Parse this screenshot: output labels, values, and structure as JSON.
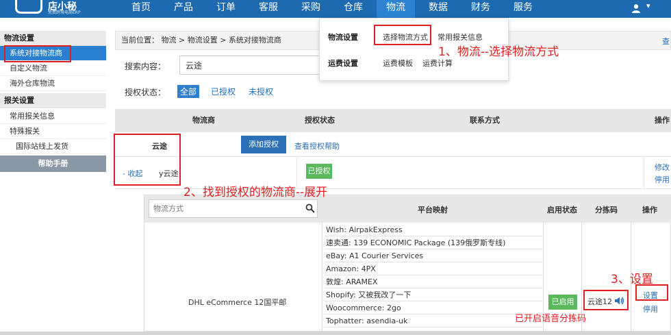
{
  "brand": {
    "name": "店小秘",
    "tagline": "免费跨境电商ERP"
  },
  "nav": {
    "items": [
      {
        "label": "首页"
      },
      {
        "label": "产品"
      },
      {
        "label": "订单"
      },
      {
        "label": "客服"
      },
      {
        "label": "采购"
      },
      {
        "label": "仓库"
      },
      {
        "label": "物流"
      },
      {
        "label": "数据"
      },
      {
        "label": "财务"
      },
      {
        "label": "服务"
      }
    ],
    "active": "物流"
  },
  "dropdown": {
    "logistics_head": "物流设置",
    "select_method": "选择物流方式",
    "customs_info": "常用报关信息",
    "freight_head": "运费设置",
    "freight_template": "运费模板",
    "freight_calc": "运费计算"
  },
  "sidebar": {
    "logistics_head": "物流设置",
    "items": [
      "系统对接物流商",
      "自定义物流",
      "海外仓库物流"
    ],
    "customs_head": "报关设置",
    "customs_items": [
      "常用报关信息",
      "特殊报关"
    ],
    "sub_item": "国际站线上发货",
    "help": "帮助手册"
  },
  "breadcrumb": {
    "text": "当前位置： 物流 > 物流设置 > 系统对接物流商",
    "right": "查"
  },
  "search": {
    "label": "搜索内容：",
    "value": "云途"
  },
  "auth_filter": {
    "label": "授权状态：",
    "tabs": [
      "全部",
      "已授权",
      "未授权"
    ]
  },
  "table": {
    "headers": [
      "物流商",
      "授权状态",
      "联系方式",
      "操作"
    ],
    "carrier": "云途",
    "add_auth": "添加授权",
    "auth_help": "查看授权帮助",
    "collapse": "- 收起",
    "sub_carrier": "y云途",
    "authed": "已授权",
    "edit": "修改",
    "disable": "停用"
  },
  "subtable": {
    "search_placeholder": "物流方式",
    "headers": [
      "平台映射",
      "启用状态",
      "分拣码",
      "操作"
    ],
    "method_name": "DHL eCommerce 12国平邮",
    "mappings": [
      "Wish:  AirpakExpress",
      "速卖通:  139 ECONOMIC Package (139俄罗斯专线)",
      "eBay:  A1 Courier Services",
      "Amazon:  4PX",
      "敦煌:  ARAMEX",
      "Shopify:  又被我改了一下",
      "Woocommerce:  2go",
      "Tophatter:  asendia-uk"
    ],
    "enabled": "已启用",
    "sort_code": "云途12",
    "set": "设置",
    "disable": "停用"
  },
  "annotations": {
    "step1": "1、物流--选择物流方式",
    "step2": "2、找到授权的物流商--展开",
    "step3": "3、设置",
    "voice_note": "已开启语音分拣码"
  },
  "colors": {
    "nav_bg": "#1d6ab0",
    "accent": "#2a7fd0",
    "success": "#5cb85c",
    "annotation": "#e02020"
  }
}
